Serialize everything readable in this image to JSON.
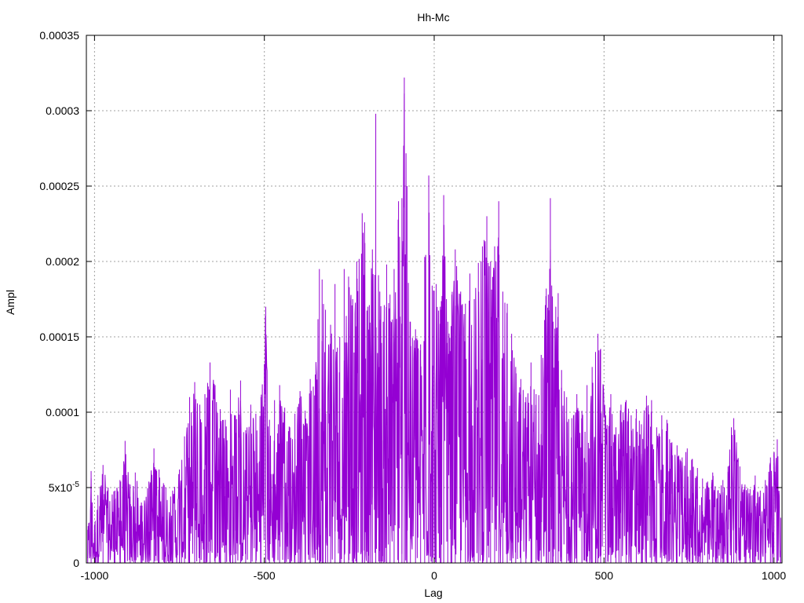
{
  "chart_data": {
    "type": "line",
    "title": "Hh-Mc",
    "xlabel": "Lag",
    "ylabel": "Ampl",
    "xlim": [
      -1024,
      1024
    ],
    "ylim": [
      0,
      0.00035
    ],
    "xticks": [
      {
        "value": -1000,
        "label": "-1000"
      },
      {
        "value": -500,
        "label": "-500"
      },
      {
        "value": 0,
        "label": "0"
      },
      {
        "value": 500,
        "label": "500"
      },
      {
        "value": 1000,
        "label": "1000"
      }
    ],
    "yticks": [
      {
        "value": 0,
        "label": "0"
      },
      {
        "value": 5e-05,
        "label": "5x10",
        "exp": "-5"
      },
      {
        "value": 0.0001,
        "label": "0.0001"
      },
      {
        "value": 0.00015,
        "label": "0.00015"
      },
      {
        "value": 0.0002,
        "label": "0.0002"
      },
      {
        "value": 0.00025,
        "label": "0.00025"
      },
      {
        "value": 0.0003,
        "label": "0.0003"
      },
      {
        "value": 0.00035,
        "label": "0.00035"
      }
    ],
    "grid": true,
    "series_color": "#9400d3",
    "series": [
      {
        "values": [
          [
            -1020,
            2.2e-05
          ],
          [
            -1010,
            6.1e-05
          ],
          [
            -998,
            2.8e-05
          ],
          [
            -990,
            4.5e-05
          ],
          [
            -975,
            6.5e-05
          ],
          [
            -960,
            5e-05
          ],
          [
            -940,
            4.8e-05
          ],
          [
            -925,
            5.5e-05
          ],
          [
            -910,
            8.1e-05
          ],
          [
            -895,
            5.2e-05
          ],
          [
            -880,
            6e-05
          ],
          [
            -860,
            3.8e-05
          ],
          [
            -840,
            5.4e-05
          ],
          [
            -825,
            7.6e-05
          ],
          [
            -810,
            6.2e-05
          ],
          [
            -790,
            5e-05
          ],
          [
            -770,
            4.8e-05
          ],
          [
            -750,
            6.2e-05
          ],
          [
            -735,
            8.4e-05
          ],
          [
            -720,
            0.00011
          ],
          [
            -705,
            0.00012
          ],
          [
            -690,
            0.000105
          ],
          [
            -675,
            0.000112
          ],
          [
            -660,
            0.000133
          ],
          [
            -645,
            0.000118
          ],
          [
            -630,
            0.000102
          ],
          [
            -615,
            9.5e-05
          ],
          [
            -600,
            0.000115
          ],
          [
            -585,
            9.8e-05
          ],
          [
            -570,
            0.000121
          ],
          [
            -555,
            8.8e-05
          ],
          [
            -540,
            0.000105
          ],
          [
            -525,
            9.9e-05
          ],
          [
            -510,
            0.00011
          ],
          [
            -496,
            0.00017
          ],
          [
            -485,
            9.5e-05
          ],
          [
            -470,
            0.000108
          ],
          [
            -455,
            0.000118
          ],
          [
            -440,
            0.000103
          ],
          [
            -425,
            9e-05
          ],
          [
            -410,
            9.9e-05
          ],
          [
            -395,
            0.000114
          ],
          [
            -380,
            0.000101
          ],
          [
            -365,
            0.000122
          ],
          [
            -350,
            0.000125
          ],
          [
            -338,
            0.000195
          ],
          [
            -330,
            0.000188
          ],
          [
            -320,
            0.000168
          ],
          [
            -305,
            0.000158
          ],
          [
            -292,
            0.000185
          ],
          [
            -278,
            0.00015
          ],
          [
            -265,
            0.000195
          ],
          [
            -252,
            0.00019
          ],
          [
            -240,
            0.000175
          ],
          [
            -228,
            0.0002
          ],
          [
            -212,
            0.000232
          ],
          [
            -205,
            0.000226
          ],
          [
            -195,
            0.00017
          ],
          [
            -182,
            0.000208
          ],
          [
            -172,
            0.000298
          ],
          [
            -160,
            0.00018
          ],
          [
            -150,
            0.00016
          ],
          [
            -140,
            0.000198
          ],
          [
            -130,
            0.000178
          ],
          [
            -118,
            0.000195
          ],
          [
            -105,
            0.00024
          ],
          [
            -95,
            0.000242
          ],
          [
            -88,
            0.000322
          ],
          [
            -80,
            0.00025
          ],
          [
            -70,
            0.00016
          ],
          [
            -55,
            0.000155
          ],
          [
            -40,
            0.000145
          ],
          [
            -28,
            0.000203
          ],
          [
            -16,
            0.000257
          ],
          [
            -6,
            0.000184
          ],
          [
            6,
            0.000185
          ],
          [
            18,
            0.00017
          ],
          [
            28,
            0.000244
          ],
          [
            40,
            0.00016
          ],
          [
            52,
            0.000178
          ],
          [
            62,
            0.000208
          ],
          [
            78,
            0.00018
          ],
          [
            92,
            0.000172
          ],
          [
            105,
            0.000192
          ],
          [
            118,
            0.000175
          ],
          [
            130,
            0.000199
          ],
          [
            142,
            0.00021
          ],
          [
            155,
            0.00023
          ],
          [
            166,
            0.0002
          ],
          [
            178,
            0.00021
          ],
          [
            190,
            0.00024
          ],
          [
            202,
            0.00018
          ],
          [
            215,
            0.000172
          ],
          [
            228,
            0.000152
          ],
          [
            240,
            0.00013
          ],
          [
            255,
            0.000122
          ],
          [
            270,
            0.00011
          ],
          [
            285,
            0.000133
          ],
          [
            300,
            0.000112
          ],
          [
            315,
            0.000138
          ],
          [
            330,
            0.000182
          ],
          [
            336,
            0.000178
          ],
          [
            342,
            0.000242
          ],
          [
            350,
            0.00016
          ],
          [
            358,
            0.00017
          ],
          [
            365,
            0.000179
          ],
          [
            375,
            0.000128
          ],
          [
            390,
            0.00011
          ],
          [
            405,
            9.6e-05
          ],
          [
            420,
            0.000112
          ],
          [
            435,
            0.000101
          ],
          [
            450,
            0.000118
          ],
          [
            465,
            0.00013
          ],
          [
            475,
            0.00014
          ],
          [
            482,
            0.000152
          ],
          [
            490,
            0.000142
          ],
          [
            505,
            9.8e-05
          ],
          [
            520,
            0.000112
          ],
          [
            535,
            9e-05
          ],
          [
            550,
            0.000105
          ],
          [
            565,
            0.000108
          ],
          [
            580,
            9.8e-05
          ],
          [
            595,
            0.000102
          ],
          [
            610,
            9.2e-05
          ],
          [
            625,
            0.000111
          ],
          [
            640,
            0.000108
          ],
          [
            655,
            9e-05
          ],
          [
            670,
            9.8e-05
          ],
          [
            685,
            9.5e-05
          ],
          [
            700,
            8e-05
          ],
          [
            715,
            7.8e-05
          ],
          [
            730,
            7e-05
          ],
          [
            745,
            7.6e-05
          ],
          [
            760,
            6.9e-05
          ],
          [
            775,
            6.3e-05
          ],
          [
            790,
            5.6e-05
          ],
          [
            805,
            5.4e-05
          ],
          [
            820,
            6e-05
          ],
          [
            835,
            4.8e-05
          ],
          [
            850,
            5.5e-05
          ],
          [
            865,
            6.4e-05
          ],
          [
            875,
            9e-05
          ],
          [
            882,
            9.6e-05
          ],
          [
            890,
            8e-05
          ],
          [
            900,
            6.4e-05
          ],
          [
            915,
            5.2e-05
          ],
          [
            930,
            4.9e-05
          ],
          [
            945,
            5.8e-05
          ],
          [
            960,
            4.8e-05
          ],
          [
            975,
            5.5e-05
          ],
          [
            990,
            7e-05
          ],
          [
            1000,
            7.3e-05
          ],
          [
            1010,
            8.2e-05
          ],
          [
            1020,
            3e-05
          ]
        ]
      }
    ]
  }
}
